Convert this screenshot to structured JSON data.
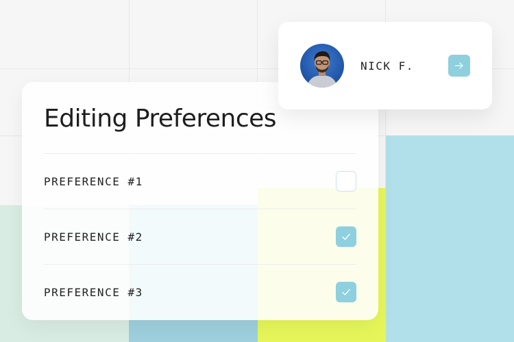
{
  "preferences_panel": {
    "title": "Editing Preferences",
    "items": [
      {
        "label": "PREFERENCE #1",
        "checked": false
      },
      {
        "label": "PREFERENCE #2",
        "checked": true
      },
      {
        "label": "PREFERENCE #3",
        "checked": true
      }
    ]
  },
  "profile": {
    "name": "NICK F.",
    "avatar_icon": "user-avatar-photo",
    "action_icon": "arrow-right-icon"
  },
  "colors": {
    "accent": "#8ed0de",
    "mint": "#d9ece3",
    "lime": "#e6f65a",
    "sky": "#b2e0ea",
    "blue": "#9ed0dd"
  }
}
